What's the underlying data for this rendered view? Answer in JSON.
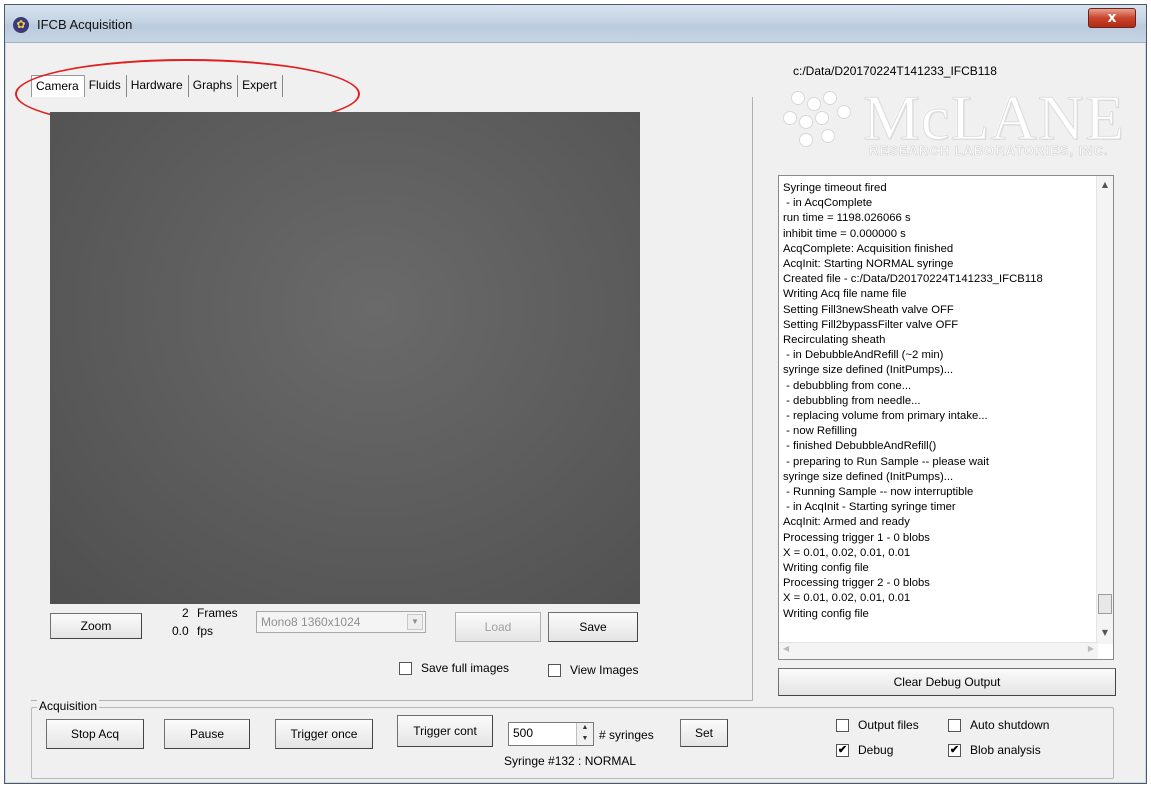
{
  "window": {
    "title": "IFCB Acquisition",
    "close_glyph": "x"
  },
  "tabs": [
    {
      "label": "Camera"
    },
    {
      "label": "Fluids"
    },
    {
      "label": "Hardware"
    },
    {
      "label": "Graphs"
    },
    {
      "label": "Expert"
    }
  ],
  "camera": {
    "zoom_label": "Zoom",
    "frames_count": "2",
    "frames_label": "Frames",
    "fps_value": "0.0",
    "fps_label": "fps",
    "format_selected": "Mono8 1360x1024",
    "load_label": "Load",
    "save_label": "Save",
    "save_full_images_label": "Save full images",
    "save_full_images_checked": false,
    "view_images_label": "View Images",
    "view_images_checked": false
  },
  "file_path": "c:/Data/D20170224T141233_IFCB118",
  "logo": {
    "name": "McLANE",
    "subtitle": "RESEARCH LABORATORIES, INC."
  },
  "debug": {
    "lines": [
      "Syringe timeout fired",
      " - in AcqComplete",
      "run time = 1198.026066 s",
      "inhibit time = 0.000000 s",
      "AcqComplete: Acquisition finished",
      "AcqInit: Starting NORMAL syringe",
      "Created file - c:/Data/D20170224T141233_IFCB118",
      "Writing Acq file name file",
      "Setting Fill3newSheath valve OFF",
      "Setting Fill2bypassFilter valve OFF",
      "Recirculating sheath",
      " - in DebubbleAndRefill (~2 min)",
      "syringe size defined (InitPumps)...",
      " - debubbling from cone...",
      " - debubbling from needle...",
      " - replacing volume from primary intake...",
      " - now Refilling",
      " - finished DebubbleAndRefill()",
      " - preparing to Run Sample -- please wait",
      "syringe size defined (InitPumps)...",
      " - Running Sample -- now interruptible",
      " - in AcqInit - Starting syringe timer",
      "AcqInit: Armed and ready",
      "Processing trigger 1 - 0 blobs",
      "X = 0.01, 0.02, 0.01, 0.01",
      "Writing config file",
      "Processing trigger 2 - 0 blobs",
      "X = 0.01, 0.02, 0.01, 0.01",
      "Writing config file"
    ],
    "text": "",
    "clear_label": "Clear Debug Output"
  },
  "acquisition": {
    "group_label": "Acquisition",
    "stop_label": "Stop Acq",
    "pause_label": "Pause",
    "trigger_once_label": "Trigger once",
    "trigger_cont_label": "Trigger cont",
    "syringes_value": "500",
    "syringes_label": "# syringes",
    "set_label": "Set",
    "syringe_status": "Syringe #132 : NORMAL"
  },
  "options": {
    "output_files": {
      "label": "Output files",
      "checked": false
    },
    "auto_shutdown": {
      "label": "Auto shutdown",
      "checked": false
    },
    "debug": {
      "label": "Debug",
      "checked": true
    },
    "blob_analysis": {
      "label": "Blob analysis",
      "checked": true
    }
  },
  "colors": {
    "annotation": "#e02020",
    "camera_view": "#5e5e5e",
    "titlebar": "#c4d3e3"
  }
}
